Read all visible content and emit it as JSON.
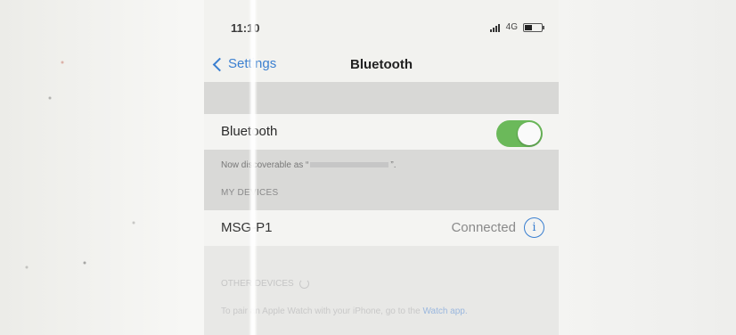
{
  "status_bar": {
    "time": "11:10",
    "network": "4G"
  },
  "nav": {
    "back_label": "Settings",
    "title": "Bluetooth"
  },
  "bluetooth_row": {
    "label": "Bluetooth",
    "toggle_on": true,
    "toggle_color": "#6bb95a"
  },
  "discoverable": {
    "prefix": "Now discoverable as “",
    "suffix": "”."
  },
  "my_devices": {
    "header": "MY DEVICES",
    "devices": [
      {
        "name": "MSG-P1",
        "status": "Connected"
      }
    ]
  },
  "other_devices": {
    "header": "OTHER DEVICES",
    "pair_text": "To pair an Apple Watch with your iPhone, go to the",
    "pair_link": "Watch app."
  },
  "colors": {
    "accent": "#3a7fd0"
  }
}
